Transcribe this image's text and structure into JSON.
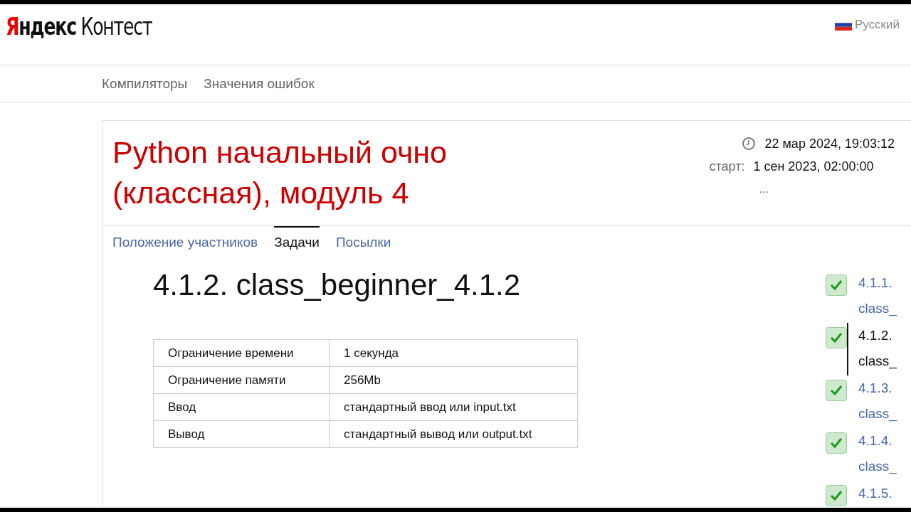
{
  "header": {
    "logo_brand": "Яндекс",
    "logo_product": "Контест",
    "language": "Русский"
  },
  "nav": [
    "Компиляторы",
    "Значения ошибок"
  ],
  "contest": {
    "title": "Python начальный очно (классная), модуль 4",
    "current_time": "22 мар 2024, 19:03:12",
    "start_label": "старт:",
    "start_time": "1 сен 2023, 02:00:00",
    "more": "..."
  },
  "tabs": [
    {
      "label": "Положение участников",
      "selected": false
    },
    {
      "label": "Задачи",
      "selected": true
    },
    {
      "label": "Посылки",
      "selected": false
    }
  ],
  "problem": {
    "title": "4.1.2. class_beginner_4.1.2",
    "limits": [
      [
        "Ограничение времени",
        "1 секунда"
      ],
      [
        "Ограничение памяти",
        "256Mb"
      ],
      [
        "Ввод",
        "стандартный ввод или input.txt"
      ],
      [
        "Вывод",
        "стандартный вывод или output.txt"
      ]
    ]
  },
  "problem_list": [
    {
      "label": "4.1.1. class_",
      "solved": true,
      "selected": false
    },
    {
      "label": "4.1.2. class_",
      "solved": true,
      "selected": true
    },
    {
      "label": "4.1.3. class_",
      "solved": true,
      "selected": false
    },
    {
      "label": "4.1.4. class_",
      "solved": true,
      "selected": false
    },
    {
      "label": "4.1.5.",
      "solved": true,
      "selected": false
    }
  ]
}
